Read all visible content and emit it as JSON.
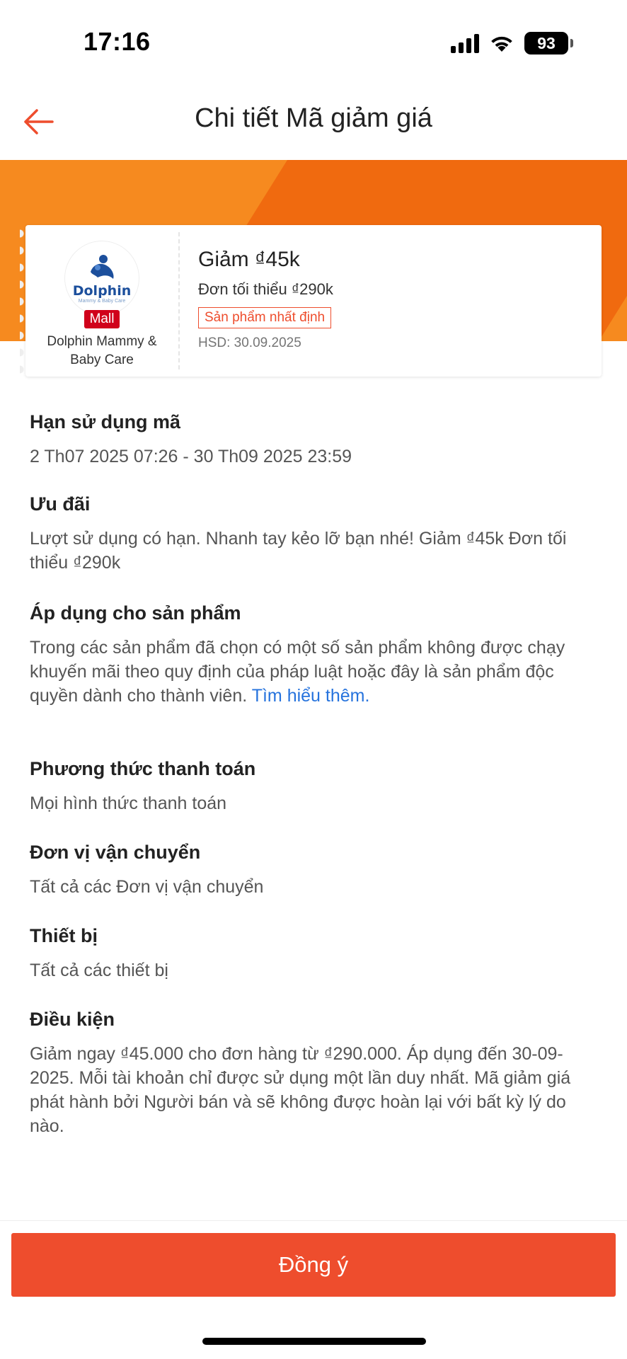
{
  "status_bar": {
    "time": "17:16",
    "battery": "93"
  },
  "header": {
    "title": "Chi tiết Mã giảm giá"
  },
  "voucher": {
    "shop_logo_text": "Dolphin",
    "shop_logo_sub": "Mammy & Baby Care",
    "mall_badge": "Mall",
    "shop_name": "Dolphin Mammy & Baby Care",
    "title": "Giảm ₫45k",
    "min_order": "Đơn tối thiểu ₫290k",
    "tag": "Sản phẩm nhất định",
    "expiry": "HSD: 30.09.2025"
  },
  "sections": {
    "validity": {
      "title": "Hạn sử dụng mã",
      "body": "2 Th07 2025 07:26 - 30 Th09 2025 23:59"
    },
    "offer": {
      "title": "Ưu đãi",
      "body": "Lượt sử dụng có hạn. Nhanh tay kẻo lỡ bạn nhé! Giảm ₫45k Đơn tối thiểu ₫290k"
    },
    "products": {
      "title": "Áp dụng cho sản phẩm",
      "body": "Trong các sản phẩm đã chọn có một số sản phẩm không được chạy khuyến mãi theo quy định của pháp luật hoặc đây là sản phẩm độc quyền dành cho thành viên.",
      "link": "Tìm hiểu thêm."
    },
    "payment": {
      "title": "Phương thức thanh toán",
      "body": "Mọi hình thức thanh toán"
    },
    "shipping": {
      "title": "Đơn vị vận chuyển",
      "body": "Tất cả các Đơn vị vận chuyển"
    },
    "device": {
      "title": "Thiết bị",
      "body": "Tất cả các thiết bị"
    },
    "conditions": {
      "title": "Điều kiện",
      "body": "Giảm ngay ₫45.000 cho đơn hàng từ ₫290.000. Áp dụng đến 30-09-2025. Mỗi tài khoản chỉ được sử dụng một lần duy nhất. Mã giảm giá phát hành bởi Người bán và sẽ không được hoàn lại với bất kỳ lý do nào."
    }
  },
  "footer": {
    "confirm_label": "Đồng ý"
  },
  "colors": {
    "accent": "#ee4d2d",
    "band_light": "#f68a1f",
    "band_dark": "#f06a0f",
    "mall": "#d0011b",
    "link": "#2673dd"
  },
  "icons": {
    "back": "arrow-left-icon",
    "signal": "cellular-signal-icon",
    "wifi": "wifi-icon",
    "battery": "battery-icon"
  }
}
